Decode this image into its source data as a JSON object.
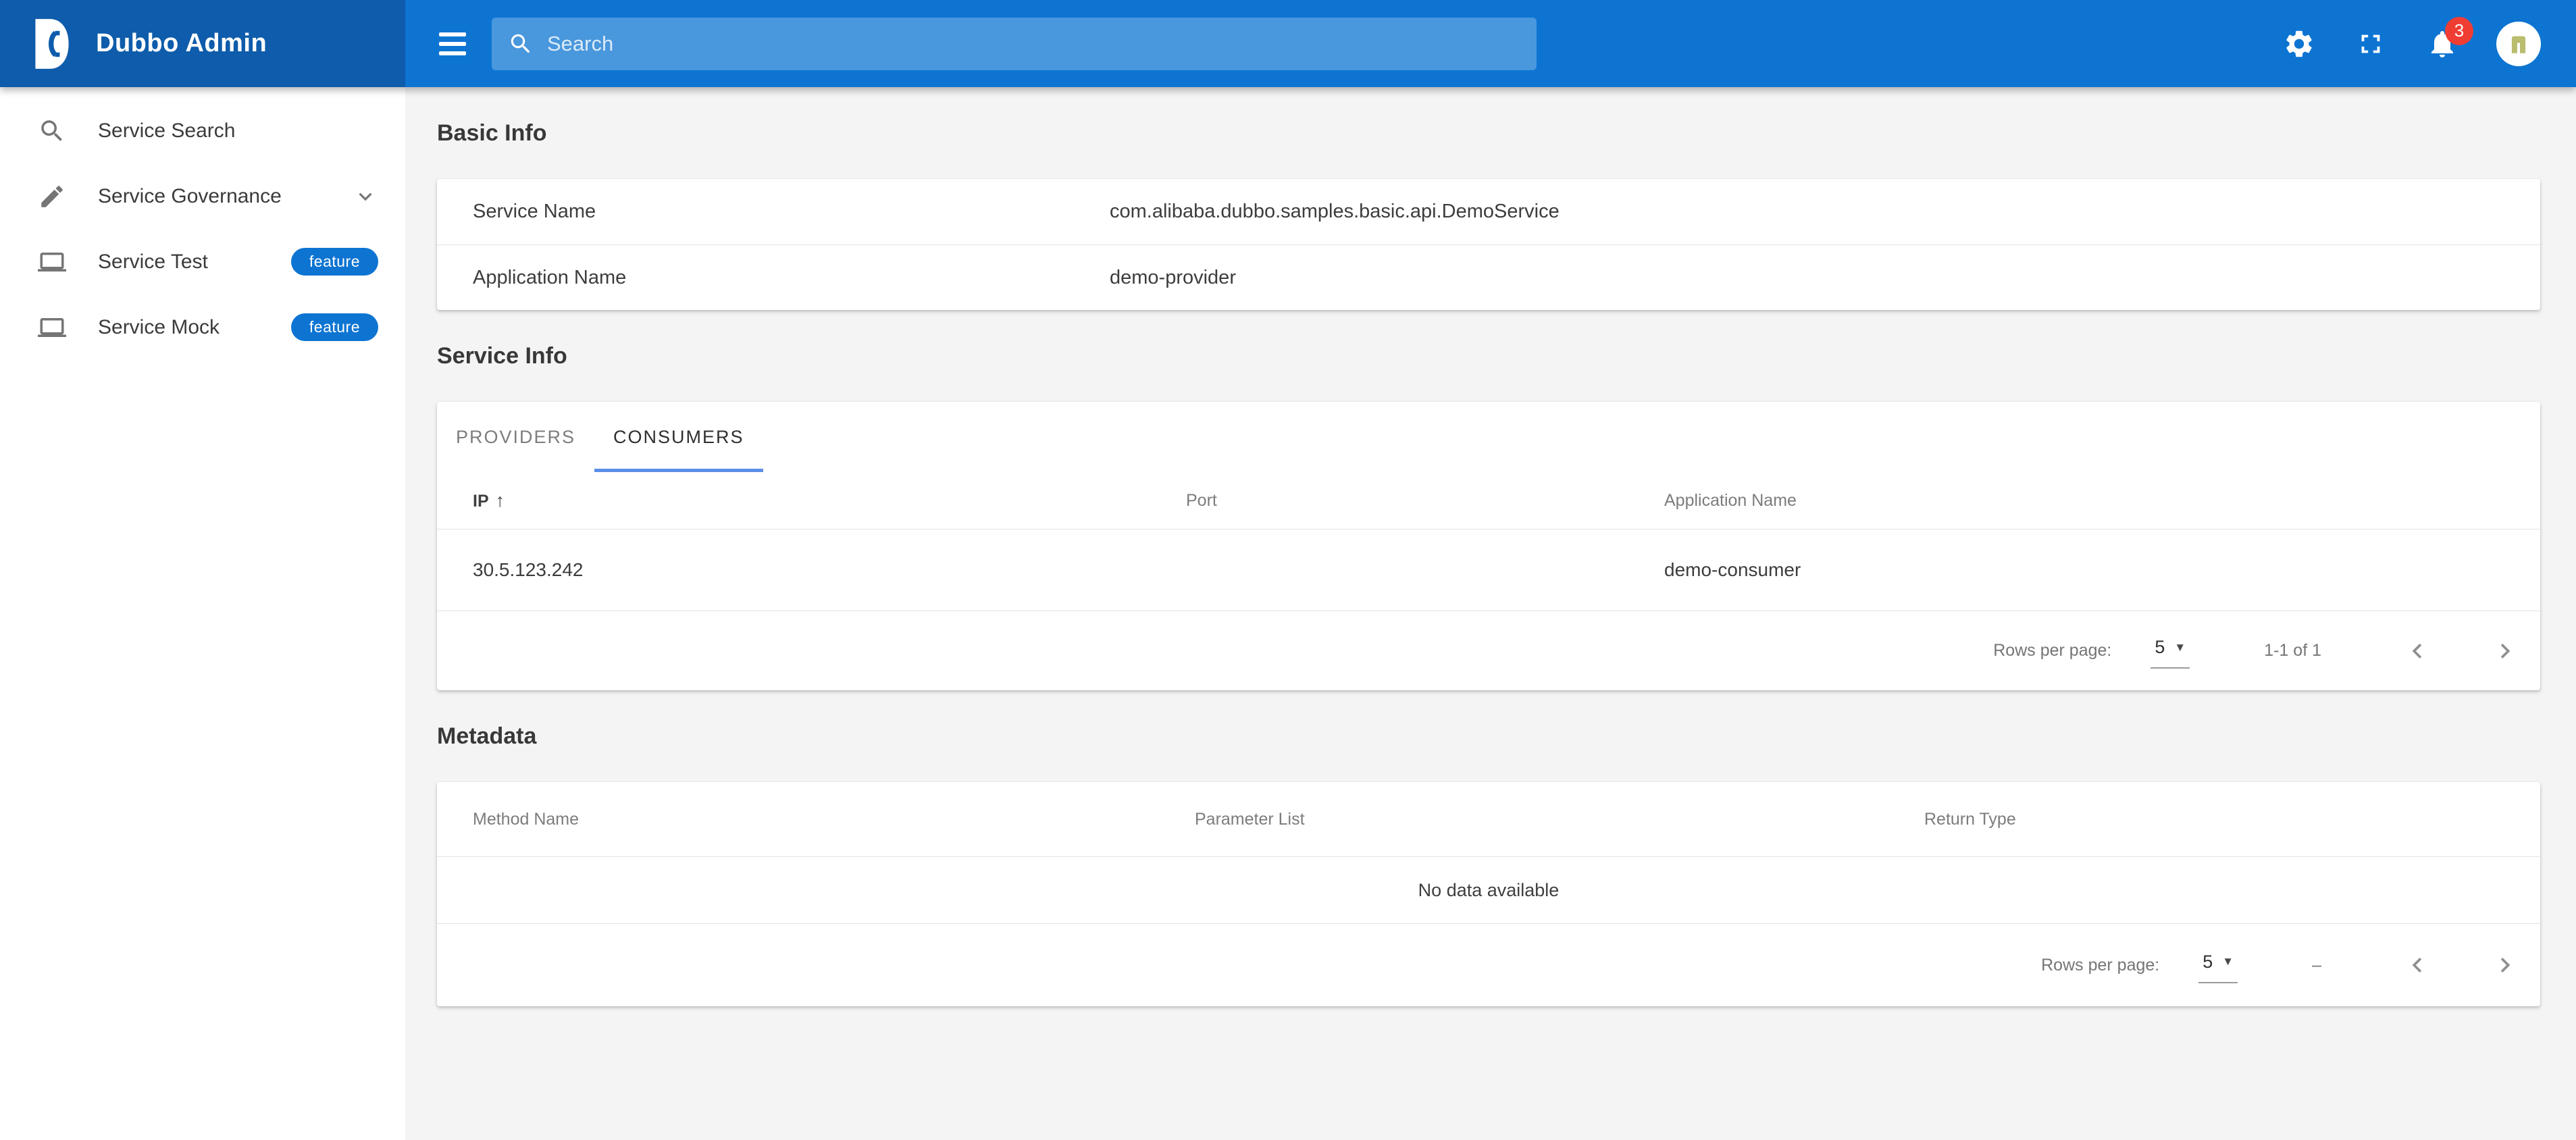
{
  "header": {
    "app_title": "Dubbo Admin",
    "search_placeholder": "Search",
    "notification_count": "3",
    "icons": [
      "hamburger-menu-icon",
      "search-icon",
      "gear-icon",
      "fullscreen-icon",
      "bell-icon",
      "avatar"
    ]
  },
  "colors": {
    "header_blue": "#0d74d2",
    "brand_dark_blue": "#0e5cab",
    "badge_blue": "#0d74d2",
    "tab_underline_blue": "#5b8fe8",
    "notification_red": "#f03d33",
    "avatar_olive": "#b9bd6e"
  },
  "sidebar": {
    "items": [
      {
        "label": "Service Search",
        "icon": "magnify-icon"
      },
      {
        "label": "Service Governance",
        "icon": "pencil-icon",
        "trailing_icon": "chevron-down-icon"
      },
      {
        "label": "Service Test",
        "icon": "laptop-icon",
        "badge": "feature"
      },
      {
        "label": "Service Mock",
        "icon": "laptop-icon",
        "badge": "feature"
      }
    ]
  },
  "basic_info": {
    "title": "Basic Info",
    "rows": [
      {
        "label": "Service Name",
        "value": "com.alibaba.dubbo.samples.basic.api.DemoService"
      },
      {
        "label": "Application Name",
        "value": "demo-provider"
      }
    ]
  },
  "service_info": {
    "title": "Service Info",
    "tabs": [
      {
        "label": "PROVIDERS",
        "active": false
      },
      {
        "label": "CONSUMERS",
        "active": true
      }
    ],
    "table": {
      "columns": [
        "IP",
        "Port",
        "Application Name"
      ],
      "sort_column": "IP",
      "sort_direction": "ascending",
      "rows": [
        {
          "ip": "30.5.123.242",
          "port": "",
          "application_name": "demo-consumer"
        }
      ],
      "footer": {
        "rows_per_page_label": "Rows per page:",
        "rows_per_page_value": "5",
        "range_label": "1-1 of 1"
      }
    }
  },
  "metadata": {
    "title": "Metadata",
    "table": {
      "columns": [
        "Method Name",
        "Parameter List",
        "Return Type"
      ],
      "empty_text": "No data available",
      "footer": {
        "rows_per_page_label": "Rows per page:",
        "rows_per_page_value": "5",
        "range_label": "–"
      }
    }
  }
}
